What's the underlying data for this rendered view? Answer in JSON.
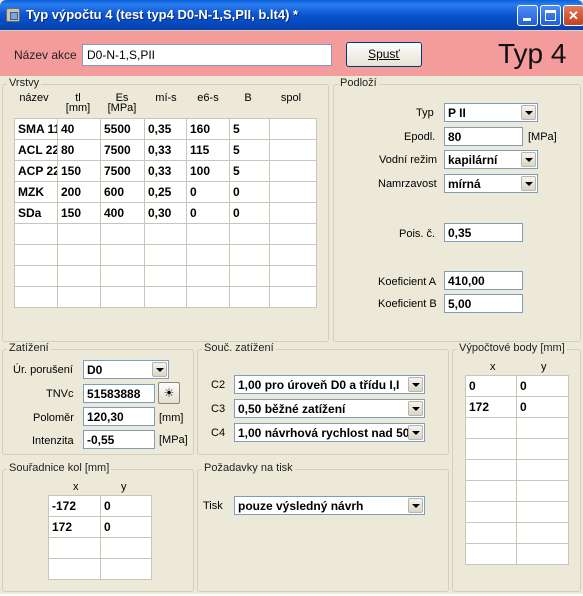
{
  "window": {
    "title": "Typ výpočtu 4 (test typ4 D0-N-1,S,PII, b.lt4) *"
  },
  "header": {
    "action_label": "Název akce",
    "action_value": "D0-N-1,S,PII",
    "run_button": "Spusť",
    "type_label": "Typ 4"
  },
  "layers": {
    "title": "Vrstvy",
    "columns": [
      {
        "name": "název",
        "unit": ""
      },
      {
        "name": "tl",
        "unit": "[mm]"
      },
      {
        "name": "Es",
        "unit": "[MPa]"
      },
      {
        "name": "mí-s",
        "unit": ""
      },
      {
        "name": "e6-s",
        "unit": ""
      },
      {
        "name": "B",
        "unit": ""
      },
      {
        "name": "spol",
        "unit": ""
      }
    ],
    "rows": [
      [
        "SMA 11",
        "40",
        "5500",
        "0,35",
        "160",
        "5",
        ""
      ],
      [
        "ACL 22",
        "80",
        "7500",
        "0,33",
        "115",
        "5",
        ""
      ],
      [
        "ACP 22",
        "150",
        "7500",
        "0,33",
        "100",
        "5",
        ""
      ],
      [
        "MZK",
        "200",
        "600",
        "0,25",
        "0",
        "0",
        ""
      ],
      [
        "SDa",
        "150",
        "400",
        "0,30",
        "0",
        "0",
        ""
      ],
      [
        "",
        "",
        "",
        "",
        "",
        "",
        ""
      ],
      [
        "",
        "",
        "",
        "",
        "",
        "",
        ""
      ],
      [
        "",
        "",
        "",
        "",
        "",
        "",
        ""
      ],
      [
        "",
        "",
        "",
        "",
        "",
        "",
        ""
      ]
    ]
  },
  "subsoil": {
    "title": "Podloží",
    "typ_label": "Typ",
    "typ_value": "P II",
    "epodl_label": "Epodl.",
    "epodl_value": "80",
    "epodl_unit": "[MPa]",
    "water_label": "Vodní režim",
    "water_value": "kapilární",
    "frost_label": "Namrzavost",
    "frost_value": "mírná",
    "pois_label": "Pois. č.",
    "pois_value": "0,35",
    "coefA_label": "Koeficient A",
    "coefA_value": "410,00",
    "coefB_label": "Koeficient B",
    "coefB_value": "5,00"
  },
  "load": {
    "title": "Zatížení",
    "level_label": "Úr. porušení",
    "level_value": "D0",
    "tnv_label": "TNVc",
    "tnv_value": "51583888",
    "radius_label": "Poloměr",
    "radius_value": "120,30",
    "radius_unit": "[mm]",
    "intensity_label": "Intenzita",
    "intensity_value": "-0,55",
    "intensity_unit": "[MPa]"
  },
  "coefficients": {
    "title": "Souč. zatížení",
    "c2_label": "C2",
    "c2_value": "1,00 pro úroveň D0 a třídu I,I",
    "c3_label": "C3",
    "c3_value": "0,50 běžné zatížení",
    "c4_label": "C4",
    "c4_value": "1,00 návrhová rychlost nad 50"
  },
  "calc_points": {
    "title": "Výpočtové body [mm]",
    "col_x": "x",
    "col_y": "y",
    "rows": [
      [
        "0",
        "0"
      ],
      [
        "172",
        "0"
      ],
      [
        "",
        ""
      ],
      [
        "",
        ""
      ],
      [
        "",
        ""
      ],
      [
        "",
        ""
      ],
      [
        "",
        ""
      ],
      [
        "",
        ""
      ],
      [
        "",
        ""
      ]
    ]
  },
  "wheels": {
    "title": "Souřadnice kol [mm]",
    "col_x": "x",
    "col_y": "y",
    "rows": [
      [
        "-172",
        "0"
      ],
      [
        "172",
        "0"
      ],
      [
        "",
        ""
      ],
      [
        "",
        ""
      ]
    ]
  },
  "print": {
    "title": "Požadavky na tisk",
    "tisk_label": "Tisk",
    "tisk_value": "pouze výsledný návrh"
  }
}
